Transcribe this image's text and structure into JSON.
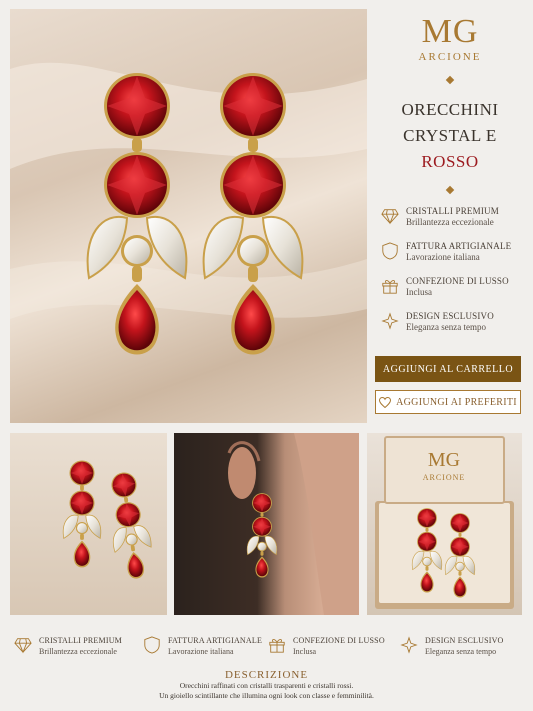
{
  "brand": {
    "mark": "MG",
    "name": "ARCIONE"
  },
  "product": {
    "title_line1": "ORECCHINI",
    "title_line2": "CRYSTAL E",
    "title_line3": "ROSSO"
  },
  "features": [
    {
      "icon": "diamond-icon",
      "title": "CRISTALLI PREMIUM",
      "subtitle": "Brillantezza eccezionale"
    },
    {
      "icon": "shield-icon",
      "title": "FATTURA ARTIGIANALE",
      "subtitle": "Lavorazione italiana"
    },
    {
      "icon": "gift-icon",
      "title": "CONFEZIONE DI LUSSO",
      "subtitle": "Inclusa"
    },
    {
      "icon": "sparkle-icon",
      "title": "DESIGN ESCLUSIVO",
      "subtitle": "Eleganza senza tempo"
    }
  ],
  "actions": {
    "add_to_cart": "AGGIUNGI AL CARRELLO",
    "add_to_favorites": "AGGIUNGI AI PREFERITI"
  },
  "box_logo": {
    "mark": "MG",
    "name": "ARCIONE"
  },
  "description": {
    "title": "DESCRIZIONE",
    "line1": "Orecchini raffinati con cristalli trasparenti e cristalli rossi.",
    "line2": "Un gioiello scintillante che illumina ogni look con classe e femminilità."
  },
  "colors": {
    "gold": "#a87932",
    "ruby": "#9c1a1f",
    "cart_button": "#7a5414"
  }
}
